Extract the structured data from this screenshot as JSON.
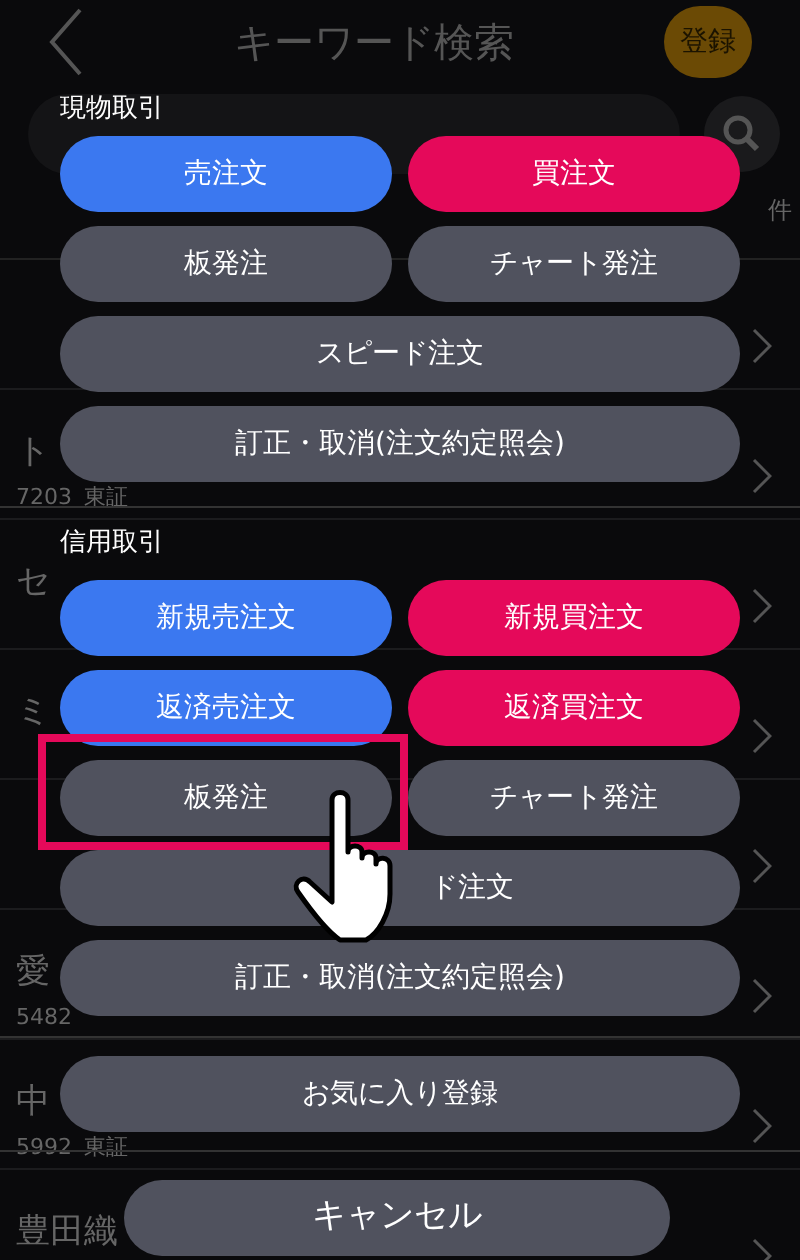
{
  "header": {
    "title": "キーワード検索",
    "register_button": "登録"
  },
  "result_unit": "件",
  "rows": [
    {},
    {
      "name": "ト",
      "code": "7203",
      "market": "東証"
    },
    {
      "name": "セ"
    },
    {
      "name": "ミ"
    },
    {},
    {
      "name": "愛",
      "code": "5482"
    },
    {
      "name": "中",
      "code": "5992",
      "market": "東証"
    },
    {
      "name": "豊田織"
    }
  ],
  "sections": [
    {
      "title": "現物取引",
      "buttons": [
        {
          "label": "売注文",
          "kind": "sell",
          "wide": false,
          "highlighted": false
        },
        {
          "label": "買注文",
          "kind": "buy",
          "wide": false,
          "highlighted": false
        },
        {
          "label": "板発注",
          "kind": "neutral",
          "wide": false,
          "highlighted": false
        },
        {
          "label": "チャート発注",
          "kind": "neutral",
          "wide": false,
          "highlighted": false
        },
        {
          "label": "スピード注文",
          "kind": "neutral",
          "wide": true,
          "highlighted": false
        },
        {
          "label": "訂正・取消(注文約定照会)",
          "kind": "neutral",
          "wide": true,
          "highlighted": false
        }
      ]
    },
    {
      "title": "信用取引",
      "buttons": [
        {
          "label": "新規売注文",
          "kind": "sell",
          "wide": false,
          "highlighted": false
        },
        {
          "label": "新規買注文",
          "kind": "buy",
          "wide": false,
          "highlighted": false
        },
        {
          "label": "返済売注文",
          "kind": "sell",
          "wide": false,
          "highlighted": false
        },
        {
          "label": "返済買注文",
          "kind": "buy",
          "wide": false,
          "highlighted": false
        },
        {
          "label": "板発注",
          "kind": "neutral",
          "wide": false,
          "highlighted": true
        },
        {
          "label": "チャート発注",
          "kind": "neutral",
          "wide": false,
          "highlighted": false
        },
        {
          "label": "ド注文",
          "kind": "neutral",
          "wide": true,
          "highlighted": false,
          "covered": true
        },
        {
          "label": "訂正・取消(注文約定照会)",
          "kind": "neutral",
          "wide": true,
          "highlighted": false
        }
      ]
    }
  ],
  "favorite_button": "お気に入り登録",
  "cancel_button": "キャンセル"
}
